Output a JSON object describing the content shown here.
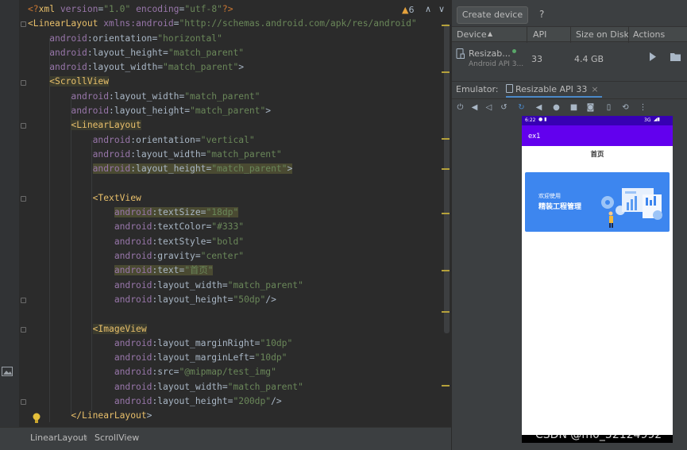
{
  "editor": {
    "warnings": "6",
    "lines": [
      [
        [
          "p",
          "<?"
        ],
        [
          "t",
          "xml "
        ],
        [
          "a",
          "version"
        ],
        [
          "d",
          "="
        ],
        [
          "v",
          "\"1.0\""
        ],
        [
          "d",
          " "
        ],
        [
          "a",
          "encoding"
        ],
        [
          "d",
          "="
        ],
        [
          "v",
          "\"utf-8\""
        ],
        [
          "p",
          "?>"
        ]
      ],
      [
        [
          "t",
          "<LinearLayout "
        ],
        [
          "a",
          "xmlns:android"
        ],
        [
          "d",
          "="
        ],
        [
          "v",
          "\"http://schemas.android.com/apk/res/android\""
        ]
      ],
      [
        [
          "d",
          "    "
        ],
        [
          "a",
          "android"
        ],
        [
          "d",
          ":orientation="
        ],
        [
          "v",
          "\"horizontal\""
        ]
      ],
      [
        [
          "d",
          "    "
        ],
        [
          "a",
          "android"
        ],
        [
          "d",
          ":layout_height="
        ],
        [
          "v",
          "\"match_parent\""
        ]
      ],
      [
        [
          "d",
          "    "
        ],
        [
          "a",
          "android"
        ],
        [
          "d",
          ":layout_width="
        ],
        [
          "v",
          "\"match_parent\""
        ],
        [
          "d",
          ">"
        ]
      ],
      [
        [
          "d",
          "    "
        ],
        [
          "t",
          "<ScrollView"
        ]
      ],
      [
        [
          "d",
          "        "
        ],
        [
          "a",
          "android"
        ],
        [
          "d",
          ":layout_width="
        ],
        [
          "v",
          "\"match_parent\""
        ]
      ],
      [
        [
          "d",
          "        "
        ],
        [
          "a",
          "android"
        ],
        [
          "d",
          ":layout_height="
        ],
        [
          "v",
          "\"match_parent\""
        ],
        [
          "d",
          ">"
        ]
      ],
      [
        [
          "d",
          "        "
        ],
        [
          "t",
          "<LinearLayout"
        ]
      ],
      [
        [
          "d",
          "            "
        ],
        [
          "a",
          "android"
        ],
        [
          "d",
          ":orientation="
        ],
        [
          "v",
          "\"vertical\""
        ]
      ],
      [
        [
          "d",
          "            "
        ],
        [
          "a",
          "android"
        ],
        [
          "d",
          ":layout_width="
        ],
        [
          "v",
          "\"match_parent\""
        ]
      ],
      [
        [
          "d",
          "            "
        ],
        [
          "a",
          "android"
        ],
        [
          "d",
          ":layout_height="
        ],
        [
          "v",
          "\"match_parent\""
        ],
        [
          "d",
          ">"
        ]
      ],
      [],
      [
        [
          "d",
          "            "
        ],
        [
          "t",
          "<TextView"
        ]
      ],
      [
        [
          "d",
          "                "
        ],
        [
          "a",
          "android"
        ],
        [
          "d",
          ":textSize="
        ],
        [
          "v",
          "\"18dp\""
        ]
      ],
      [
        [
          "d",
          "                "
        ],
        [
          "a",
          "android"
        ],
        [
          "d",
          ":textColor="
        ],
        [
          "v",
          "\"#333\""
        ]
      ],
      [
        [
          "d",
          "                "
        ],
        [
          "a",
          "android"
        ],
        [
          "d",
          ":textStyle="
        ],
        [
          "v",
          "\"bold\""
        ]
      ],
      [
        [
          "d",
          "                "
        ],
        [
          "a",
          "android"
        ],
        [
          "d",
          ":gravity="
        ],
        [
          "v",
          "\"center\""
        ]
      ],
      [
        [
          "d",
          "                "
        ],
        [
          "a",
          "android"
        ],
        [
          "d",
          ":text="
        ],
        [
          "v",
          "\"首页\""
        ]
      ],
      [
        [
          "d",
          "                "
        ],
        [
          "a",
          "android"
        ],
        [
          "d",
          ":layout_width="
        ],
        [
          "v",
          "\"match_parent\""
        ]
      ],
      [
        [
          "d",
          "                "
        ],
        [
          "a",
          "android"
        ],
        [
          "d",
          ":layout_height="
        ],
        [
          "v",
          "\"50dp\""
        ],
        [
          "d",
          "/>"
        ]
      ],
      [],
      [
        [
          "d",
          "            "
        ],
        [
          "t",
          "<ImageView"
        ]
      ],
      [
        [
          "d",
          "                "
        ],
        [
          "a",
          "android"
        ],
        [
          "d",
          ":layout_marginRight="
        ],
        [
          "v",
          "\"10dp\""
        ]
      ],
      [
        [
          "d",
          "                "
        ],
        [
          "a",
          "android"
        ],
        [
          "d",
          ":layout_marginLeft="
        ],
        [
          "v",
          "\"10dp\""
        ]
      ],
      [
        [
          "d",
          "                "
        ],
        [
          "a",
          "android"
        ],
        [
          "d",
          ":src="
        ],
        [
          "v",
          "\"@mipmap/test_img\""
        ]
      ],
      [
        [
          "d",
          "                "
        ],
        [
          "a",
          "android"
        ],
        [
          "d",
          ":layout_width="
        ],
        [
          "v",
          "\"match_parent\""
        ]
      ],
      [
        [
          "d",
          "                "
        ],
        [
          "a",
          "android"
        ],
        [
          "d",
          ":layout_height="
        ],
        [
          "v",
          "\"200dp\""
        ],
        [
          "d",
          "/>"
        ]
      ],
      [
        [
          "d",
          "        "
        ],
        [
          "t",
          "</LinearLayout"
        ],
        [
          "d",
          ">"
        ]
      ]
    ]
  },
  "statusbar": {
    "crumb1": "LinearLayout",
    "crumb2": "ScrollView"
  },
  "device_manager": {
    "create_label": "Create device",
    "help_label": "?",
    "columns": [
      "Device",
      "API",
      "Size on Disk",
      "Actions"
    ],
    "device": {
      "name": "Resizab...",
      "sub": "Android API 3...",
      "api": "33",
      "size": "4.4 GB"
    }
  },
  "emulator": {
    "label": "Emulator:",
    "tab": "Resizable API 33"
  },
  "phone": {
    "time": "6:22",
    "signal": "3G",
    "app_title": "ex1",
    "page_title": "首页",
    "banner_line1": "欢迎使用",
    "banner_line2": "精装工程管理"
  },
  "watermark": "CSDN @m0_52124992",
  "colors": {
    "accent": "#6200ee",
    "status": "#3700b3",
    "banner": "#3d86ef"
  }
}
